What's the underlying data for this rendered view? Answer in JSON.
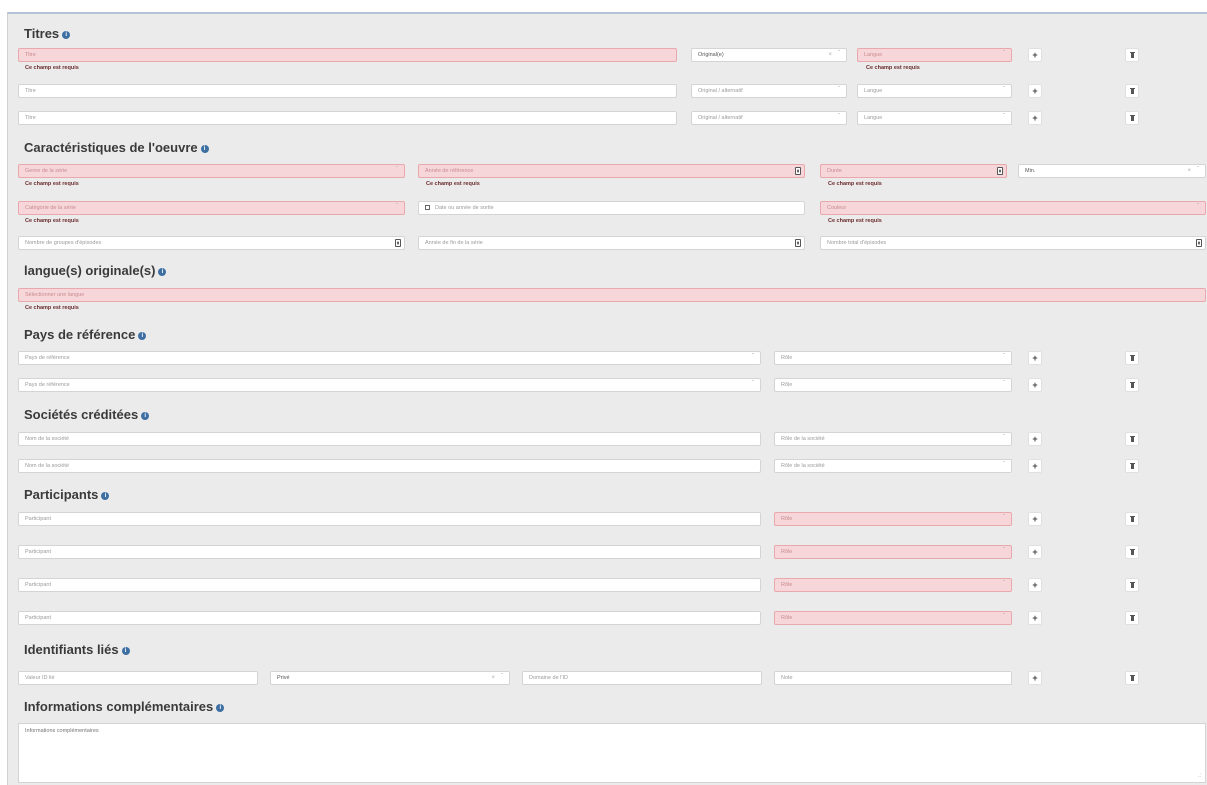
{
  "required_msg": "Ce champ est requis",
  "sections": {
    "titres": "Titres",
    "caracteristiques": "Caractéristiques de l'oeuvre",
    "langues": "langue(s) originale(s)",
    "pays": "Pays de référence",
    "societes": "Sociétés créditées",
    "participants": "Participants",
    "identifiants": "Identifiants liés",
    "infos": "Informations complémentaires"
  },
  "info_icon": "i",
  "add_label": "+",
  "titres": {
    "rows": [
      {
        "titre": "Titre",
        "type": "Original(e)",
        "langue": "Langue"
      },
      {
        "titre": "Titre",
        "type": "Original / alternatif",
        "langue": "Langue"
      },
      {
        "titre": "Titre",
        "type": "Original / alternatif",
        "langue": "Langue"
      }
    ]
  },
  "caracteristiques": {
    "genre": "Genre de la série",
    "annee_ref": "Année de référence",
    "duree": "Durée",
    "unite": "Min.",
    "categorie": "Catégorie de la série",
    "date_sortie": "Date ou année de sortie",
    "couleur": "Couleur",
    "nb_groupes": "Nombre de groupes d'épisodes",
    "annee_fin": "Année de fin de la série",
    "nb_episodes": "Nombre total d'épisodes"
  },
  "langues": {
    "placeholder": "Sélectionner une langue"
  },
  "pays": {
    "rows": [
      {
        "pays": "Pays de référence",
        "role": "Rôle"
      },
      {
        "pays": "Pays de référence",
        "role": "Rôle"
      }
    ]
  },
  "societes": {
    "rows": [
      {
        "nom": "Nom de la société",
        "role": "Rôle de la société"
      },
      {
        "nom": "Nom de la société",
        "role": "Rôle de la société"
      }
    ]
  },
  "participants": {
    "rows": [
      {
        "nom": "Participant",
        "role": "Rôle"
      },
      {
        "nom": "Participant",
        "role": "Rôle"
      },
      {
        "nom": "Participant",
        "role": "Rôle"
      },
      {
        "nom": "Participant",
        "role": "Rôle"
      }
    ]
  },
  "identifiants": {
    "valeur": "Valeur ID lié",
    "visibilite": "Privé",
    "domaine": "Domaine de l'ID",
    "note": "Note"
  },
  "infos": {
    "placeholder": "Informations complémentaires"
  },
  "colors": {
    "error_bg": "#f6d6d9",
    "error_border": "#e9a8ae",
    "accent": "#3e6fa3"
  },
  "icons": [
    "info-icon",
    "plus-icon",
    "trash-icon",
    "caret-down-icon",
    "clear-icon",
    "spinner-icon",
    "calendar-icon",
    "resize-grip-icon"
  ]
}
